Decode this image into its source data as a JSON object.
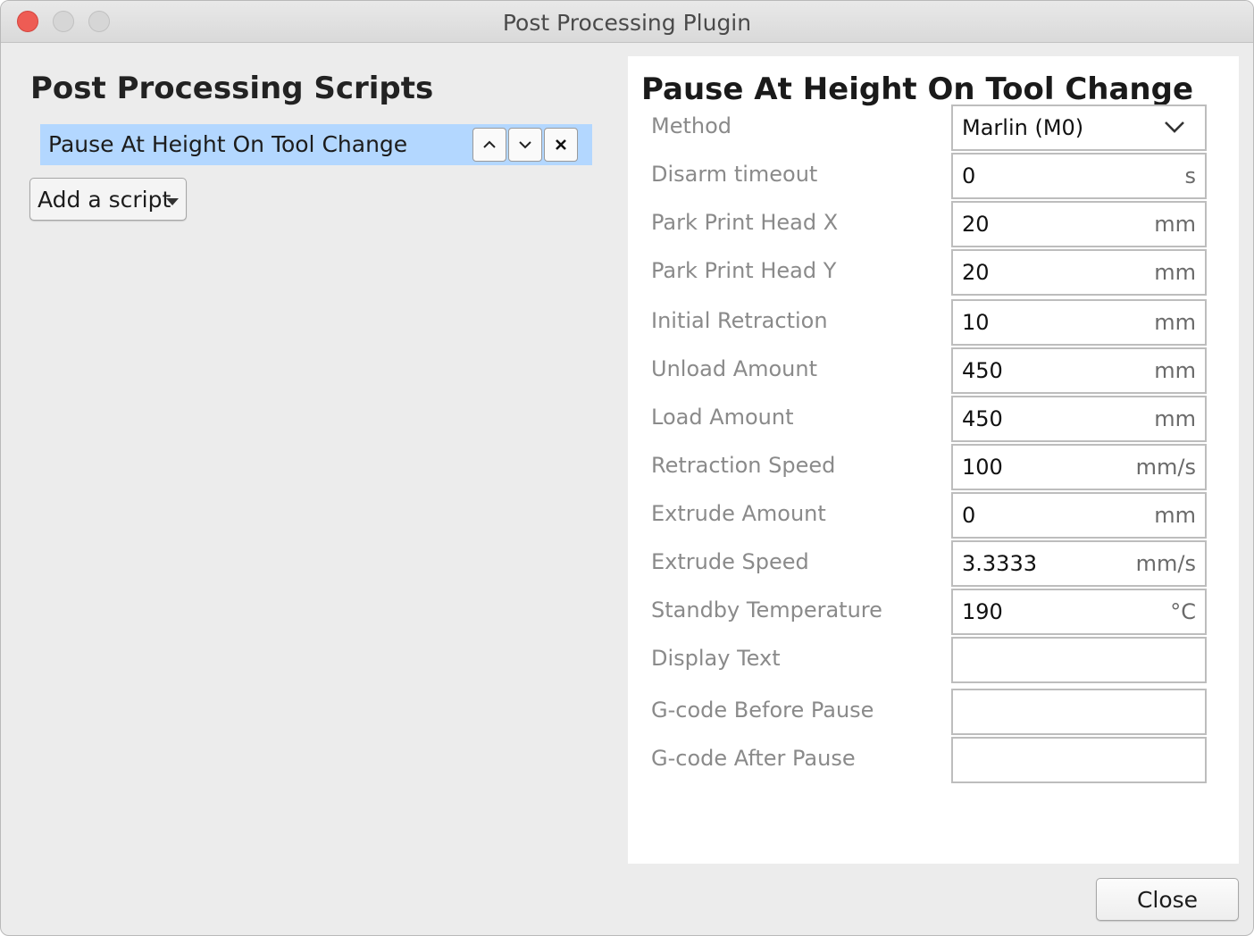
{
  "window": {
    "title": "Post Processing Plugin"
  },
  "left": {
    "heading": "Post Processing Scripts",
    "scripts": [
      {
        "label": "Pause At Height On Tool Change",
        "selected": true
      }
    ],
    "add_script_label": "Add a script"
  },
  "panel": {
    "heading": "Pause At Height On Tool Change",
    "fields": [
      {
        "label": "Method",
        "value": "Marlin (M0)",
        "unit": "",
        "type": "dropdown"
      },
      {
        "label": "Disarm timeout",
        "value": "0",
        "unit": "s"
      },
      {
        "label": "Park Print Head X",
        "value": "20",
        "unit": "mm"
      },
      {
        "label": "Park Print Head Y",
        "value": "20",
        "unit": "mm"
      },
      {
        "label": "Initial Retraction",
        "value": "10",
        "unit": "mm"
      },
      {
        "label": "Unload Amount",
        "value": "450",
        "unit": "mm"
      },
      {
        "label": "Load Amount",
        "value": "450",
        "unit": "mm"
      },
      {
        "label": "Retraction Speed",
        "value": "100",
        "unit": "mm/s"
      },
      {
        "label": "Extrude Amount",
        "value": "0",
        "unit": "mm"
      },
      {
        "label": "Extrude Speed",
        "value": "3.3333",
        "unit": "mm/s"
      },
      {
        "label": "Standby Temperature",
        "value": "190",
        "unit": "°C"
      },
      {
        "label": "Display Text",
        "value": "",
        "unit": ""
      },
      {
        "label": "G-code Before Pause",
        "value": "",
        "unit": ""
      },
      {
        "label": "G-code After Pause",
        "value": "",
        "unit": ""
      }
    ]
  },
  "footer": {
    "close_label": "Close"
  },
  "colors": {
    "selection": "#b3d7ff",
    "window_bg": "#ececec",
    "close_traffic": "#ee5c54",
    "label_gray": "#8a8a8a"
  }
}
